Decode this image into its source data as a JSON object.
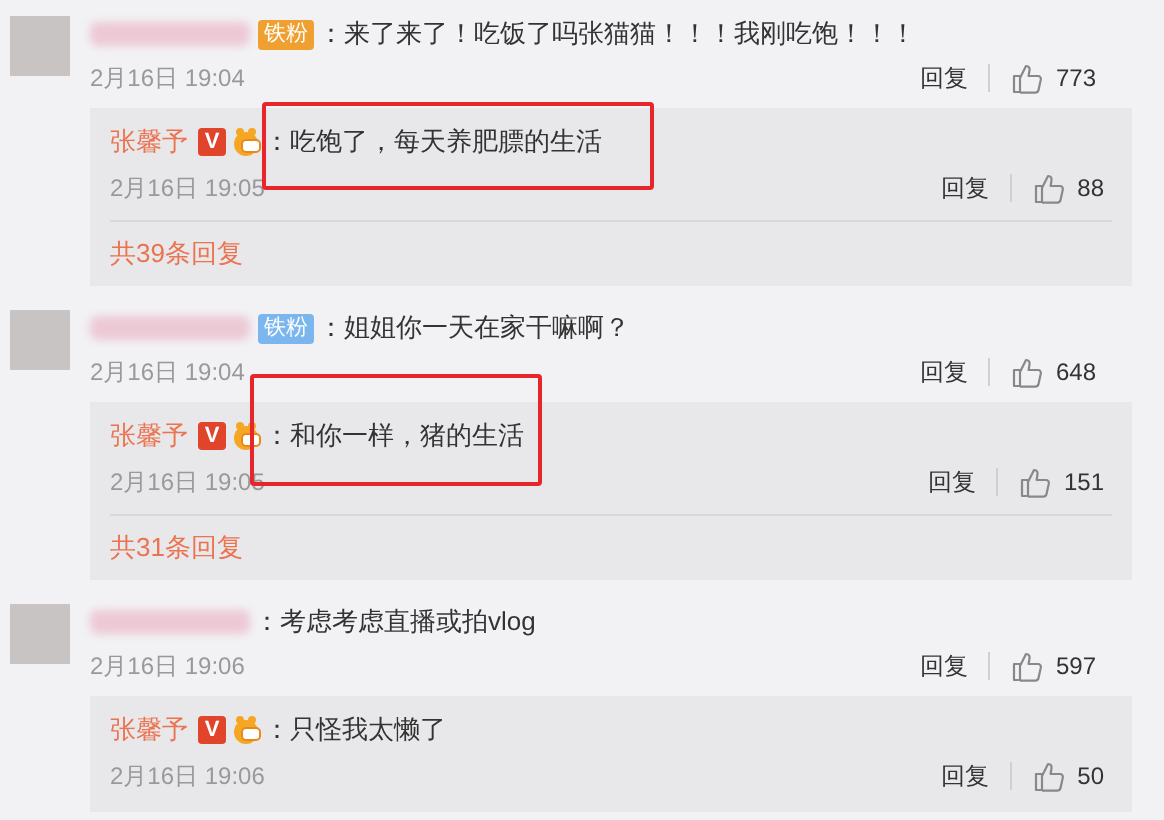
{
  "comments": [
    {
      "fan_badge": {
        "label": "铁粉",
        "color": "#f0a030"
      },
      "text": "：来了来了！吃饭了吗张猫猫！！！我刚吃饱！！！",
      "time": "2月16日 19:04",
      "reply_label": "回复",
      "likes": "773",
      "reply": {
        "author": "张馨予",
        "verified": "V",
        "text": "：吃饱了，每天养肥膘的生活",
        "time": "2月16日 19:05",
        "reply_label": "回复",
        "likes": "88",
        "highlighted": true
      },
      "more": "共39条回复"
    },
    {
      "fan_badge": {
        "label": "铁粉",
        "color": "#7cb6ee"
      },
      "text": "：姐姐你一天在家干嘛啊？",
      "time": "2月16日 19:04",
      "reply_label": "回复",
      "likes": "648",
      "reply": {
        "author": "张馨予",
        "verified": "V",
        "text": "：和你一样，猪的生活",
        "time": "2月16日 19:05",
        "reply_label": "回复",
        "likes": "151",
        "highlighted": true
      },
      "more": "共31条回复"
    },
    {
      "text": "：考虑考虑直播或拍vlog",
      "time": "2月16日 19:06",
      "reply_label": "回复",
      "likes": "597",
      "reply": {
        "author": "张馨予",
        "verified": "V",
        "text": "：只怪我太懒了",
        "time": "2月16日 19:06",
        "reply_label": "回复",
        "likes": "50",
        "highlighted": false
      }
    }
  ]
}
